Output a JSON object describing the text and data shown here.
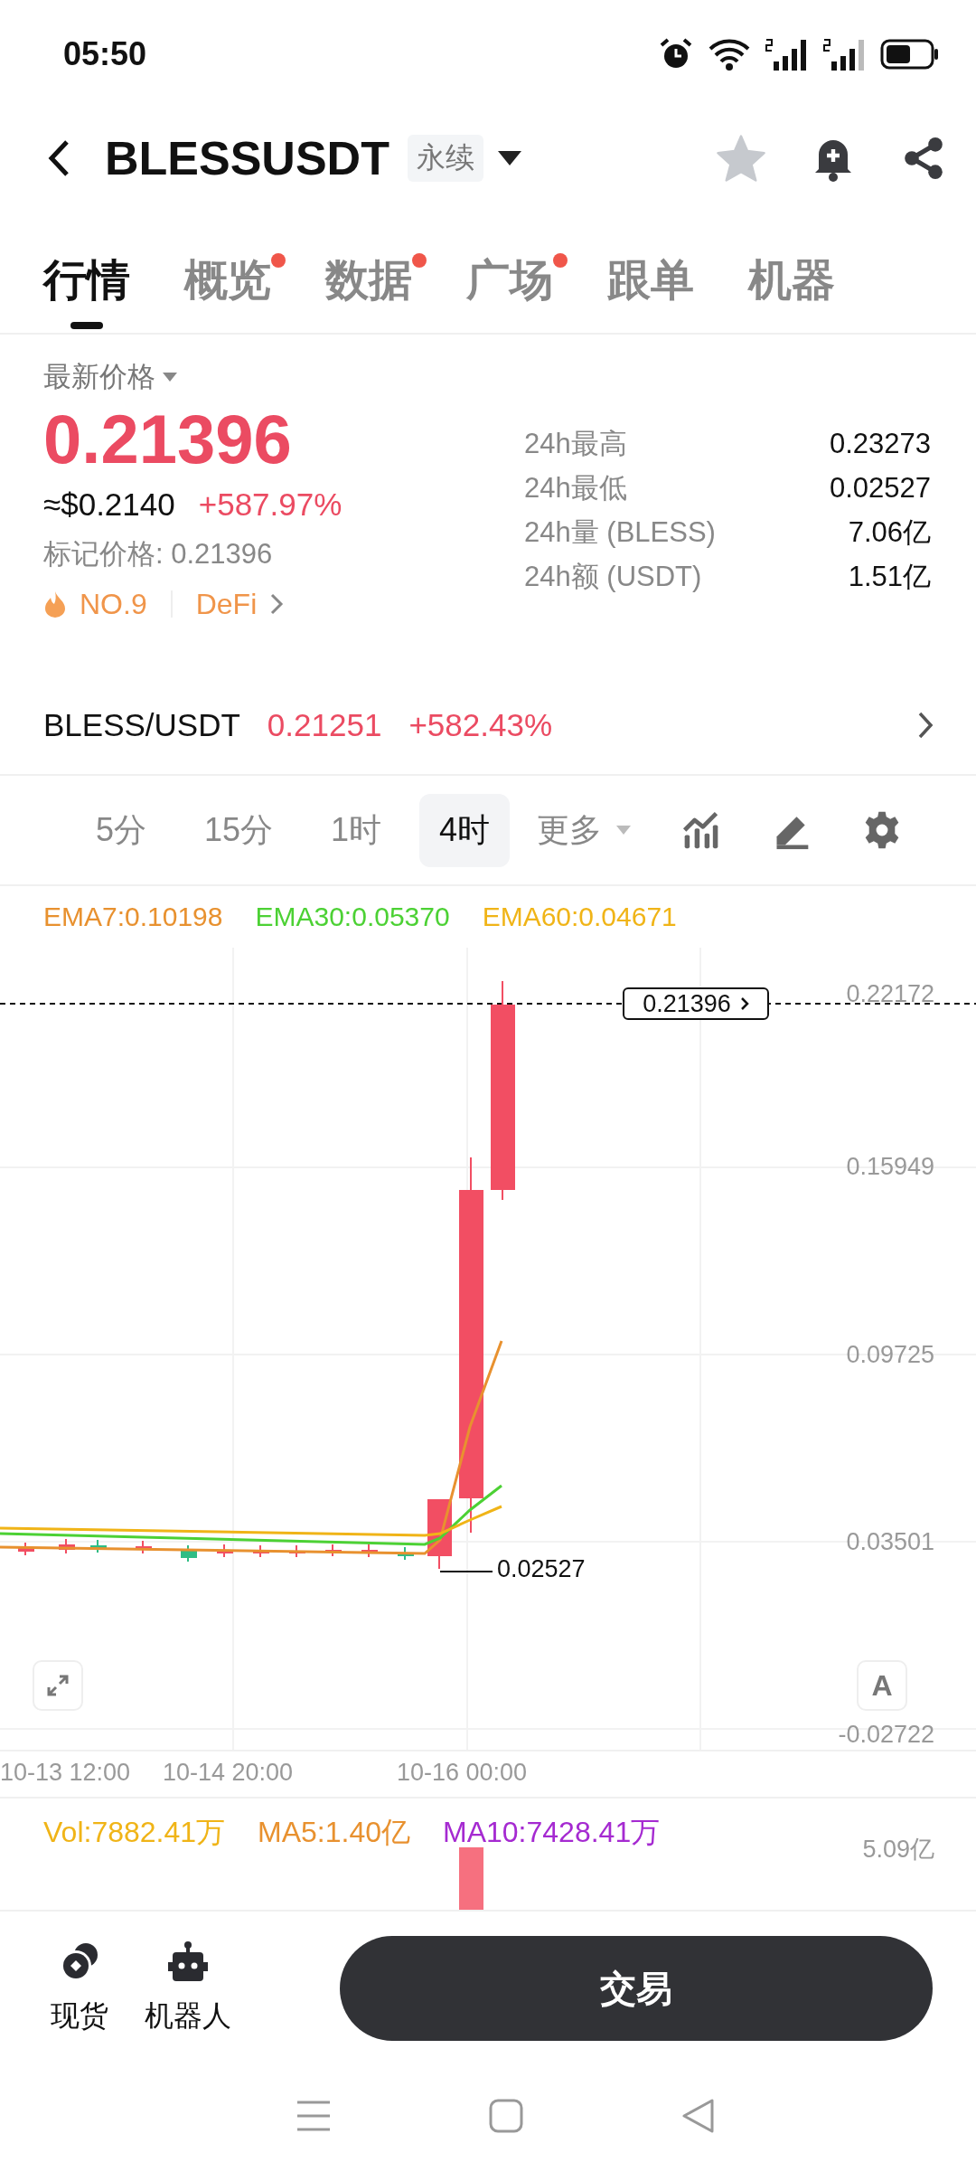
{
  "status_bar": {
    "time": "05:50"
  },
  "header": {
    "symbol": "BLESSUSDT",
    "contract_type": "永续"
  },
  "tabs": [
    {
      "label": "行情",
      "selected": true,
      "dot": false
    },
    {
      "label": "概览",
      "selected": false,
      "dot": true
    },
    {
      "label": "数据",
      "selected": false,
      "dot": true
    },
    {
      "label": "广场",
      "selected": false,
      "dot": true
    },
    {
      "label": "跟单",
      "selected": false,
      "dot": false
    },
    {
      "label": "机器",
      "selected": false,
      "dot": false
    }
  ],
  "price": {
    "label": "最新价格",
    "last": "0.21396",
    "usd": "≈$0.2140",
    "change": "+587.97%",
    "mark_price": "标记价格: 0.21396",
    "rank": "NO.9",
    "sector": "DeFi"
  },
  "stats": [
    {
      "label": "24h最高",
      "value": "0.23273"
    },
    {
      "label": "24h最低",
      "value": "0.02527"
    },
    {
      "label": "24h量 (BLESS)",
      "value": "7.06亿"
    },
    {
      "label": "24h额 (USDT)",
      "value": "1.51亿"
    }
  ],
  "spot": {
    "pair": "BLESS/USDT",
    "price": "0.21251",
    "change": "+582.43%"
  },
  "intervals": [
    {
      "label": "5分",
      "selected": false
    },
    {
      "label": "15分",
      "selected": false
    },
    {
      "label": "1时",
      "selected": false
    },
    {
      "label": "4时",
      "selected": true
    }
  ],
  "more": "更多",
  "indicators": [
    {
      "text": "EMA7:0.10198",
      "color": "#e8912f"
    },
    {
      "text": "EMA30:0.05370",
      "color": "#4cd134"
    },
    {
      "text": "EMA60:0.04671",
      "color": "#f0b417"
    }
  ],
  "chart": {
    "price_axis": [
      "0.22172",
      "0.15949",
      "0.09725",
      "0.03501",
      "-0.02722"
    ],
    "current_price": "0.21396",
    "low_label": "0.02527",
    "scale_button": "A",
    "time_axis": [
      "10-13 12:00",
      "10-14 20:00",
      "10-16 00:00"
    ]
  },
  "volume": {
    "indicators": [
      {
        "text": "Vol:7882.41万",
        "color": "#f0b417"
      },
      {
        "text": "MA5:1.40亿",
        "color": "#e8912f"
      },
      {
        "text": "MA10:7428.41万",
        "color": "#a52ad1"
      }
    ],
    "axis_max": "5.09亿"
  },
  "bottom_bar": {
    "items": [
      {
        "label": "现货",
        "kind": "spot"
      },
      {
        "label": "机器人",
        "kind": "robot"
      }
    ],
    "trade_button": "交易"
  }
}
